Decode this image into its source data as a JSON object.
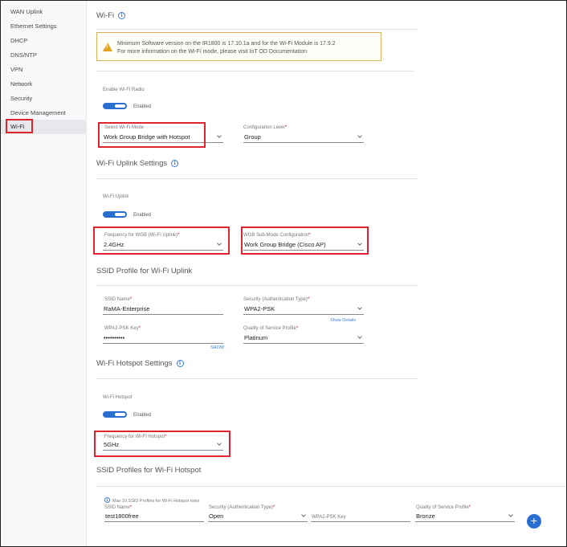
{
  "sidebar": {
    "items": [
      {
        "label": "WAN Uplink"
      },
      {
        "label": "Ethernet Settings"
      },
      {
        "label": "DHCP"
      },
      {
        "label": "DNS/NTP"
      },
      {
        "label": "VPN"
      },
      {
        "label": "Network"
      },
      {
        "label": "Security"
      },
      {
        "label": "Device Management"
      },
      {
        "label": "Wi-Fi"
      }
    ]
  },
  "wifi": {
    "title": "Wi-Fi",
    "warning_line1": "Minimum Software version on the IR1800 is 17.10.1a and for the Wi-Fi Module is 17.9.2",
    "warning_line2": "For more information on the Wi-Fi mode, please visit IoT OD Documentation",
    "enable_label": "Enable Wi-Fi Radio",
    "enable_state": "Enabled",
    "mode_label": "Select Wi-Fi Mode",
    "mode_value": "Work Group Bridge with Hotspot",
    "config_level_label": "Configuration Level",
    "config_level_value": "Group"
  },
  "uplink": {
    "title": "Wi-Fi Uplink Settings",
    "toggle_label": "Wi-Fi Uplink",
    "toggle_state": "Enabled",
    "freq_label": "Frequency for WGB (Wi-Fi Uplink)",
    "freq_value": "2.4GHz",
    "submode_label": "WGB Sub-Mode Configuration",
    "submode_value": "Work Group Bridge (Cisco AP)"
  },
  "ssid_uplink": {
    "title": "SSID Profile for Wi-Fi Uplink",
    "ssid_label": "SSID Name",
    "ssid_value": "RaMA-Enterprise",
    "security_label": "Security (Authentication Type)",
    "security_value": "WPA2-PSK",
    "show_details": "Show Details",
    "psk_label": "WPA2-PSK Key",
    "psk_value": "••••••••••",
    "show": "SHOW",
    "qos_label": "Quality of Service Profile",
    "qos_value": "Platinum"
  },
  "hotspot": {
    "title": "Wi-Fi Hotspot Settings",
    "toggle_label": "Wi-Fi Hotspot",
    "toggle_state": "Enabled",
    "freq_label": "Frequency for Wi-Fi Hotspot",
    "freq_value": "5GHz"
  },
  "ssid_hotspot": {
    "title": "SSID Profiles for Wi-Fi Hotspot",
    "note": "Max 10 SSID Profiles for Wi-Fi Hotspot roles",
    "ssid_label": "SSID Name",
    "ssid_value": "test1800free",
    "security_label": "Security (Authentication Type)",
    "security_value": "Open",
    "psk_label": "WPA2-PSK Key",
    "psk_value": "",
    "qos_label": "Quality of Service Profile",
    "qos_value": "Bronze",
    "add_label": "+"
  },
  "required_mark": "*",
  "info_glyph": "i",
  "warn_glyph": "!",
  "colors": {
    "accent": "#2a6ed1",
    "highlight": "#e0242f",
    "warning": "#e0a21f"
  }
}
